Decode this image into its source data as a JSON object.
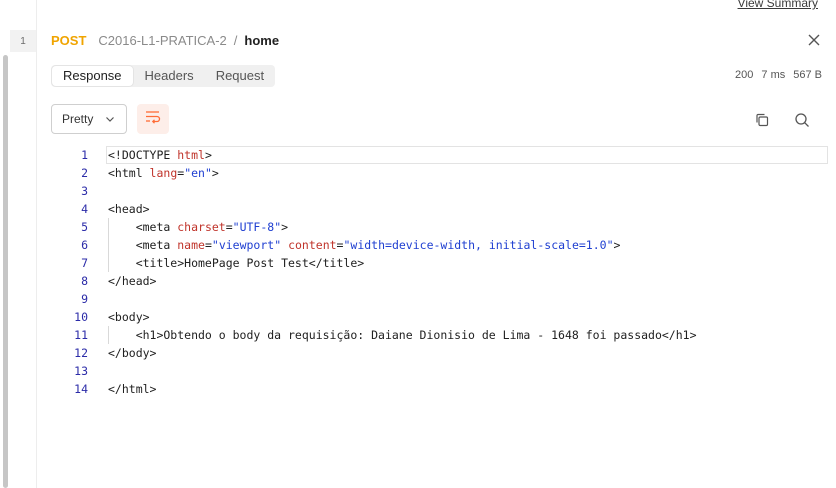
{
  "top_link": "View Summary",
  "rail": {
    "badge": "1"
  },
  "header": {
    "method": "POST",
    "collection": "C2016-L1-PRATICA-2",
    "separator": "/",
    "request": "home"
  },
  "tabs": [
    {
      "label": "Response",
      "active": true
    },
    {
      "label": "Headers",
      "active": false
    },
    {
      "label": "Request",
      "active": false
    }
  ],
  "status": {
    "code": "200",
    "time": "7 ms",
    "size": "567 B"
  },
  "toolbar": {
    "format": "Pretty"
  },
  "icons": {
    "close": "close-icon",
    "chevron": "chevron-down-icon",
    "wrap": "wrap-lines-icon",
    "copy": "copy-icon",
    "search": "search-icon"
  },
  "colors": {
    "method": "#f0a400",
    "accent": "#ff6c37",
    "attr": "#c0342b",
    "value": "#1f3fd1"
  },
  "code_lines": [
    {
      "num": "1",
      "segments": [
        {
          "t": "t",
          "s": "<!DOCTYPE "
        },
        {
          "t": "a",
          "s": "html"
        },
        {
          "t": "t",
          "s": ">"
        }
      ]
    },
    {
      "num": "2",
      "segments": [
        {
          "t": "t",
          "s": "<html "
        },
        {
          "t": "a",
          "s": "lang"
        },
        {
          "t": "t",
          "s": "="
        },
        {
          "t": "v",
          "s": "\"en\""
        },
        {
          "t": "t",
          "s": ">"
        }
      ]
    },
    {
      "num": "3",
      "segments": []
    },
    {
      "num": "4",
      "segments": [
        {
          "t": "t",
          "s": "<head>"
        }
      ]
    },
    {
      "num": "5",
      "segments": [
        {
          "t": "t",
          "s": "    <meta "
        },
        {
          "t": "a",
          "s": "charset"
        },
        {
          "t": "t",
          "s": "="
        },
        {
          "t": "v",
          "s": "\"UTF-8\""
        },
        {
          "t": "t",
          "s": ">"
        }
      ]
    },
    {
      "num": "6",
      "segments": [
        {
          "t": "t",
          "s": "    <meta "
        },
        {
          "t": "a",
          "s": "name"
        },
        {
          "t": "t",
          "s": "="
        },
        {
          "t": "v",
          "s": "\"viewport\""
        },
        {
          "t": "t",
          "s": " "
        },
        {
          "t": "a",
          "s": "content"
        },
        {
          "t": "t",
          "s": "="
        },
        {
          "t": "v",
          "s": "\"width=device-width, initial-scale=1.0\""
        },
        {
          "t": "t",
          "s": ">"
        }
      ]
    },
    {
      "num": "7",
      "segments": [
        {
          "t": "t",
          "s": "    <title>HomePage Post Test</title>"
        }
      ]
    },
    {
      "num": "8",
      "segments": [
        {
          "t": "t",
          "s": "</head>"
        }
      ]
    },
    {
      "num": "9",
      "segments": []
    },
    {
      "num": "10",
      "segments": [
        {
          "t": "t",
          "s": "<body>"
        }
      ]
    },
    {
      "num": "11",
      "segments": [
        {
          "t": "t",
          "s": "    <h1>Obtendo o body da requisição: Daiane Dionisio de Lima - 1648 foi passado</h1>"
        }
      ]
    },
    {
      "num": "12",
      "segments": [
        {
          "t": "t",
          "s": "</body>"
        }
      ]
    },
    {
      "num": "13",
      "segments": []
    },
    {
      "num": "14",
      "segments": [
        {
          "t": "t",
          "s": "</html>"
        }
      ]
    }
  ]
}
